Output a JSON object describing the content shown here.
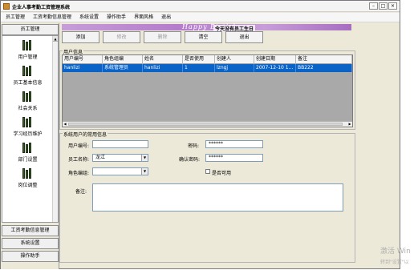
{
  "window": {
    "title": "企业人事考勤工资管理系统",
    "controls": [
      "–",
      "□",
      "×"
    ]
  },
  "menu": [
    "员工管理",
    "工资考勤信息管理",
    "系统设置",
    "操作助手",
    "界面风格",
    "退出"
  ],
  "sidebar": {
    "header": "员工管理",
    "scroll_up": "▲",
    "items": [
      {
        "label": "用户管理",
        "icon": "books-icon"
      },
      {
        "label": "员工基本信息",
        "icon": "books-icon"
      },
      {
        "label": "社会关系",
        "icon": "books-icon"
      },
      {
        "label": "学习经历维护",
        "icon": "books-icon"
      },
      {
        "label": "部门设置",
        "icon": "books-icon"
      },
      {
        "label": "岗位调整",
        "icon": "books-icon"
      }
    ],
    "footer_sections": [
      "工资考勤信息管理",
      "系统设置",
      "操作助手"
    ]
  },
  "banner": {
    "text": "Happy Birthday",
    "notice": "今天没有员工生日"
  },
  "toolbar": [
    {
      "label": "添加",
      "enabled": true
    },
    {
      "label": "修改",
      "enabled": false
    },
    {
      "label": "删除",
      "enabled": false
    },
    {
      "label": "清空",
      "enabled": true
    },
    {
      "label": "退出",
      "enabled": true
    }
  ],
  "user_info": {
    "group_title": "用户信息",
    "columns": [
      "用户编号",
      "角色组编",
      "姓名",
      "是否使用",
      "创建人",
      "创建日期",
      "备注"
    ],
    "rows": [
      [
        "hanlizi",
        "系统管理员",
        "hanlizi",
        "1",
        "lzngj",
        "2007-12-10 1...",
        "BB222"
      ]
    ],
    "scroll_left": "◀",
    "scroll_right": "▶"
  },
  "form": {
    "group_title": "系统用户的常用信息",
    "user_id_label": "用户编号:",
    "user_id_value": "",
    "password_label": "密码:",
    "password_value": "******",
    "employee_name_label": "员工名称:",
    "employee_name_value": "龙江",
    "confirm_password_label": "确认密码:",
    "confirm_password_value": "******",
    "role_group_label": "角色编组:",
    "role_group_value": "",
    "enabled_label": "是否可用",
    "enabled_checked": false,
    "remark_label": "备注:",
    "remark_value": "",
    "dropdown_arrow": "▼"
  },
  "watermark": {
    "line1": "激活 Win",
    "line2": "转到\"设置\"以"
  }
}
